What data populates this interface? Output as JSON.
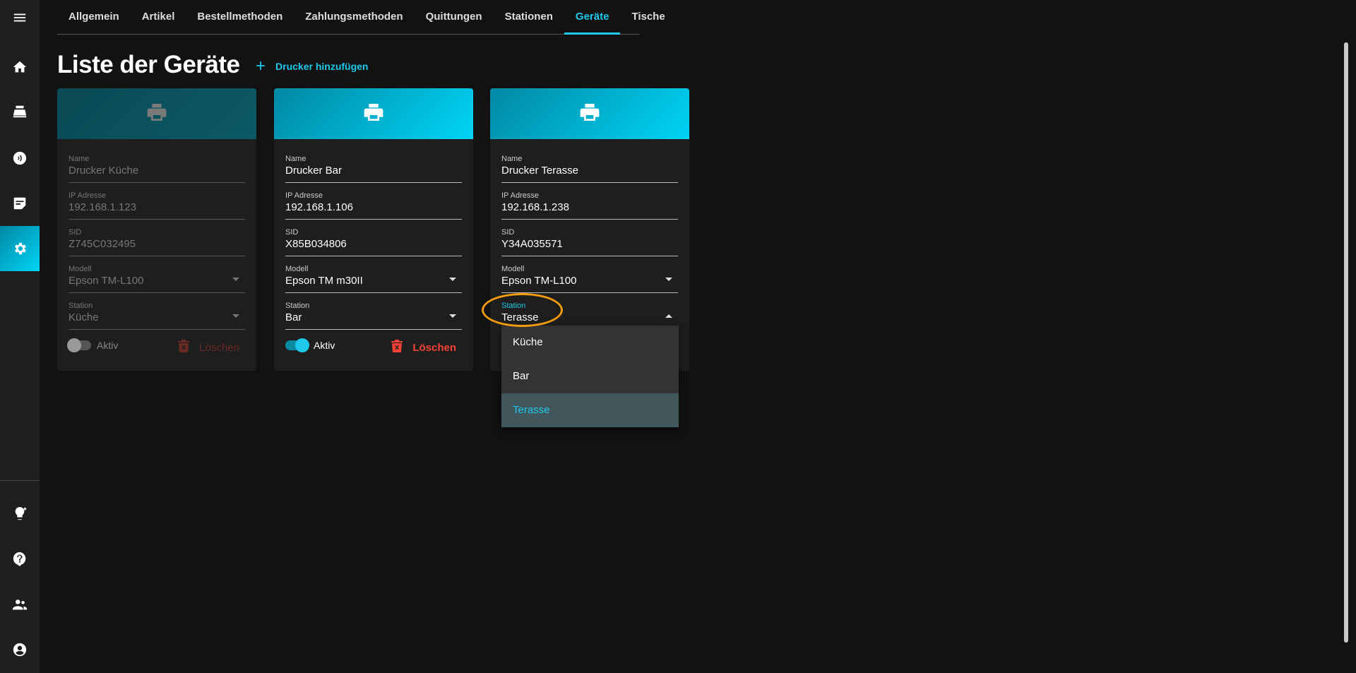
{
  "tabs": [
    {
      "label": "Allgemein"
    },
    {
      "label": "Artikel"
    },
    {
      "label": "Bestellmethoden"
    },
    {
      "label": "Zahlungsmethoden"
    },
    {
      "label": "Quittungen"
    },
    {
      "label": "Stationen"
    },
    {
      "label": "Geräte",
      "active": true
    },
    {
      "label": "Tische"
    }
  ],
  "page": {
    "title": "Liste der Geräte",
    "add_label": "Drucker hinzufügen"
  },
  "accent": "#1ec8ea",
  "labels": {
    "name": "Name",
    "ip": "IP Adresse",
    "sid": "SID",
    "model": "Modell",
    "station": "Station",
    "active": "Aktiv",
    "delete": "Löschen"
  },
  "printers": [
    {
      "name": "Drucker Küche",
      "ip": "192.168.1.123",
      "sid": "Z745C032495",
      "model": "Epson TM-L100",
      "station": "Küche",
      "active": false
    },
    {
      "name": "Drucker Bar",
      "ip": "192.168.1.106",
      "sid": "X85B034806",
      "model": "Epson TM m30II",
      "station": "Bar",
      "active": true
    },
    {
      "name": "Drucker Terasse",
      "ip": "192.168.1.238",
      "sid": "Y34A035571",
      "model": "Epson TM-L100",
      "station": "Terasse",
      "active": true
    }
  ],
  "station_menu": {
    "options": [
      "Küche",
      "Bar",
      "Terasse"
    ],
    "selected": "Terasse"
  }
}
